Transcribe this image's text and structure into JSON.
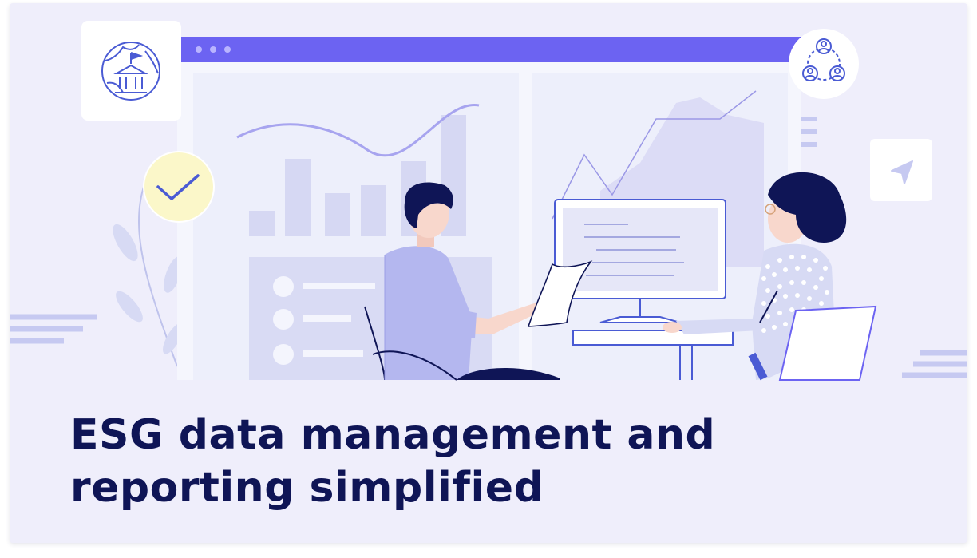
{
  "headline": "ESG data management and reporting simplified",
  "colors": {
    "background": "#efeefb",
    "browser_bar": "#6c63f2",
    "navy": "#0f1556",
    "lavender": "#d6d8f3",
    "accent_blue": "#4a5bd4",
    "check_badge": "#fbf7c9"
  },
  "icons": [
    "globe-government-icon",
    "people-network-icon",
    "checkmark-icon",
    "navigation-arrow-icon"
  ]
}
